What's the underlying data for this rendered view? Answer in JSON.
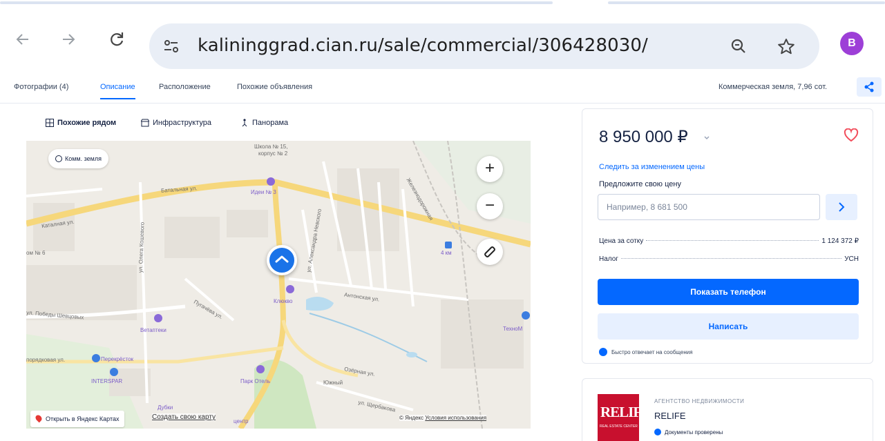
{
  "browser": {
    "url": "kalininggrad.cian.ru/sale/commercial/306428030/",
    "avatar_letter": "B"
  },
  "page_nav": {
    "tabs": [
      {
        "label": "Фотографии (4)",
        "active": false
      },
      {
        "label": "Описание",
        "active": true
      },
      {
        "label": "Расположение",
        "active": false
      },
      {
        "label": "Похожие объявления",
        "active": false
      }
    ],
    "meta": "Коммерческая земля, 7,96 сот."
  },
  "map_toolbar": {
    "similar_nearby": "Похожие рядом",
    "infrastructure": "Инфраструктура",
    "panorama": "Панорама"
  },
  "map": {
    "filter_chip": "Комм. земля",
    "zoom_in": "+",
    "zoom_out": "−",
    "open_yandex": "Открыть в Яндекс Картах",
    "create_map": "Создать свою карту",
    "copyright": "© Яндекс",
    "terms": "Условия использования",
    "labels": {
      "school": "Школа № 15,",
      "school2": "корпус № 2",
      "batalnaya": "Батальная ул.",
      "idea": "Идеи № 3",
      "oleg": "ул. Олега Кошевого",
      "katalskaya": "Каталная ул.",
      "dom": "ом № 6",
      "klyukvo": "Клюкво",
      "pugachev": "Пугачёва ул.",
      "lobovoi": "ул. Победы Шевцовых",
      "vetaptek": "Ветаптеки",
      "poryadkovaya": "порядковая ул.",
      "perekrestok": "Перекрёсток",
      "interspar": "INTERSPAR",
      "park_otel": "Парк Отель",
      "yuzhny": "Южный",
      "ozernaya": "Озёрная ул.",
      "shcherbakov": "ул. Щербакова",
      "dubki": "Дубки",
      "center": "центр",
      "km4": "4 км",
      "prom": "ТехноМ",
      "zheleznaya": "Железнодорожная",
      "antonskaya": "Антонская ул.",
      "aleksandr": "ул. Александра Невского"
    }
  },
  "offer": {
    "price": "8 950 000 ₽",
    "follow_link": "Следить за изменением цены",
    "offer_label": "Предложите свою цену",
    "offer_placeholder": "Например, 8 681 500",
    "rows": [
      {
        "label": "Цена за сотку",
        "value": "1 124 372 ₽"
      },
      {
        "label": "Налог",
        "value": "УСН"
      }
    ],
    "show_phone": "Показать телефон",
    "write": "Написать",
    "fast_reply": "Быстро отвечает на сообщения"
  },
  "agency": {
    "logo_text": "RELIFE",
    "logo_sub": "REAL ESTATE CENTER",
    "type": "АГЕНТСТВО НЕДВИЖИМОСТИ",
    "name": "RELIFE",
    "docs": "Документы проверены"
  },
  "colors": {
    "accent": "#0468ff",
    "accent_light": "#e7f0ff",
    "text": "#152242",
    "heart": "#f24d5b",
    "relife_red": "#c8102e"
  }
}
